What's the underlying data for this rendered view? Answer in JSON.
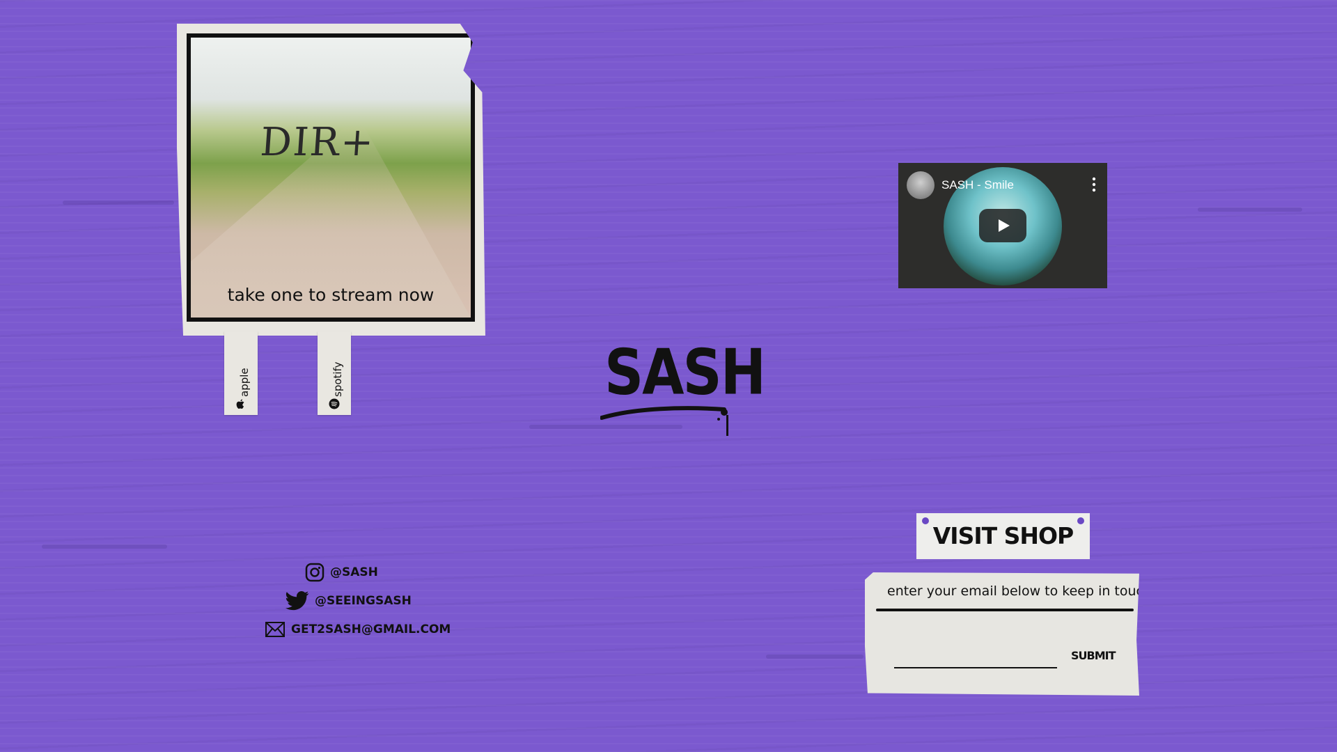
{
  "album": {
    "title": "DIR+",
    "caption": "take one to stream now",
    "tabs": [
      {
        "label": "apple",
        "icon": "apple-icon"
      },
      {
        "label": "spotify",
        "icon": "spotify-icon"
      }
    ]
  },
  "video": {
    "title": "SASH - Smile",
    "play_icon": "play-icon",
    "menu_icon": "more-vert-icon"
  },
  "logo": {
    "text": "SASH"
  },
  "social": {
    "instagram": "@SASH",
    "twitter": "@SEEINGSASH",
    "email": "GET2SASH@GMAIL.COM"
  },
  "shop": {
    "label": "VISIT SHOP"
  },
  "newsletter": {
    "prompt": "enter your email below to keep in touch",
    "email_value": "",
    "submit_label": "SUBMIT"
  },
  "colors": {
    "background": "#7b59cf",
    "paper": "#e9e7e1",
    "ink": "#111111",
    "pin": "#6a48c4"
  }
}
